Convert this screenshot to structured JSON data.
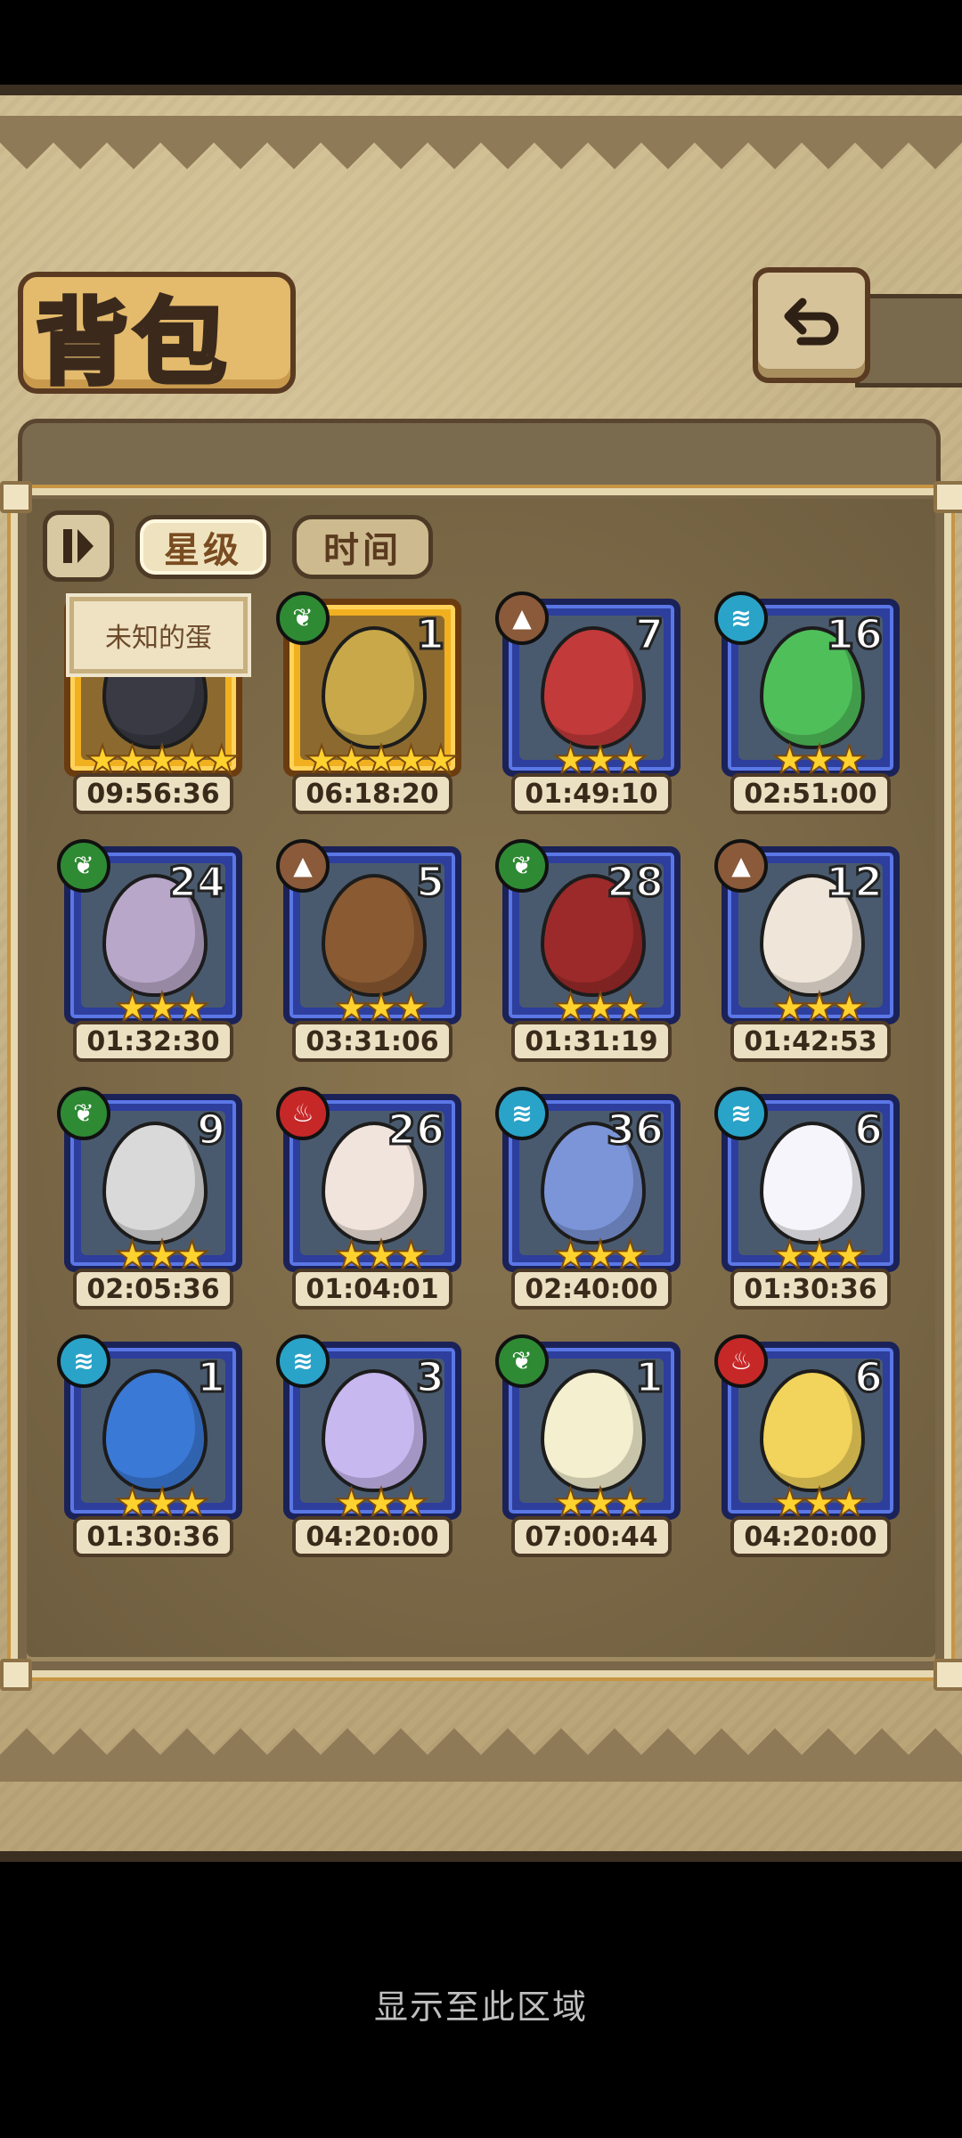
{
  "title": "背包",
  "tabs": {
    "star": "星级",
    "time": "时间"
  },
  "tooltip": "未知的蛋",
  "caption": "显示至此区域",
  "colors": {
    "water": "#2aa3c8",
    "grass": "#2f8a34",
    "earth": "#8a5a3a",
    "fire": "#c62828"
  },
  "items": [
    {
      "element": "",
      "count": "",
      "stars": "★★★★★",
      "timer": "09:56:36",
      "egg": "#3a3a44",
      "gold": true
    },
    {
      "element": "grass",
      "count": "1",
      "stars": "★★★★★",
      "timer": "06:18:20",
      "egg": "#c9a84a",
      "gold": true
    },
    {
      "element": "earth",
      "count": "7",
      "stars": "★★★",
      "timer": "01:49:10",
      "egg": "#c23a3a",
      "gold": false
    },
    {
      "element": "water",
      "count": "16",
      "stars": "★★★",
      "timer": "02:51:00",
      "egg": "#4fbf5a",
      "gold": false
    },
    {
      "element": "grass",
      "count": "24",
      "stars": "★★★",
      "timer": "01:32:30",
      "egg": "#b9a7c9",
      "gold": false
    },
    {
      "element": "earth",
      "count": "5",
      "stars": "★★★",
      "timer": "03:31:06",
      "egg": "#8a5a32",
      "gold": false
    },
    {
      "element": "grass",
      "count": "28",
      "stars": "★★★",
      "timer": "01:31:19",
      "egg": "#9c2a2a",
      "gold": false
    },
    {
      "element": "earth",
      "count": "12",
      "stars": "★★★",
      "timer": "01:42:53",
      "egg": "#efe5d9",
      "gold": false
    },
    {
      "element": "grass",
      "count": "9",
      "stars": "★★★",
      "timer": "02:05:36",
      "egg": "#d9d9d9",
      "gold": false
    },
    {
      "element": "fire",
      "count": "26",
      "stars": "★★★",
      "timer": "01:04:01",
      "egg": "#f1e4dc",
      "gold": false
    },
    {
      "element": "water",
      "count": "36",
      "stars": "★★★",
      "timer": "02:40:00",
      "egg": "#7c95d8",
      "gold": false
    },
    {
      "element": "water",
      "count": "6",
      "stars": "★★★",
      "timer": "01:30:36",
      "egg": "#f5f5fb",
      "gold": false
    },
    {
      "element": "water",
      "count": "1",
      "stars": "★★★",
      "timer": "01:30:36",
      "egg": "#3b79d6",
      "gold": false
    },
    {
      "element": "water",
      "count": "3",
      "stars": "★★★",
      "timer": "04:20:00",
      "egg": "#c7b8ef",
      "gold": false
    },
    {
      "element": "grass",
      "count": "1",
      "stars": "★★★",
      "timer": "07:00:44",
      "egg": "#f3efcf",
      "gold": false
    },
    {
      "element": "fire",
      "count": "6",
      "stars": "★★★",
      "timer": "04:20:00",
      "egg": "#f2d35b",
      "gold": false
    }
  ]
}
